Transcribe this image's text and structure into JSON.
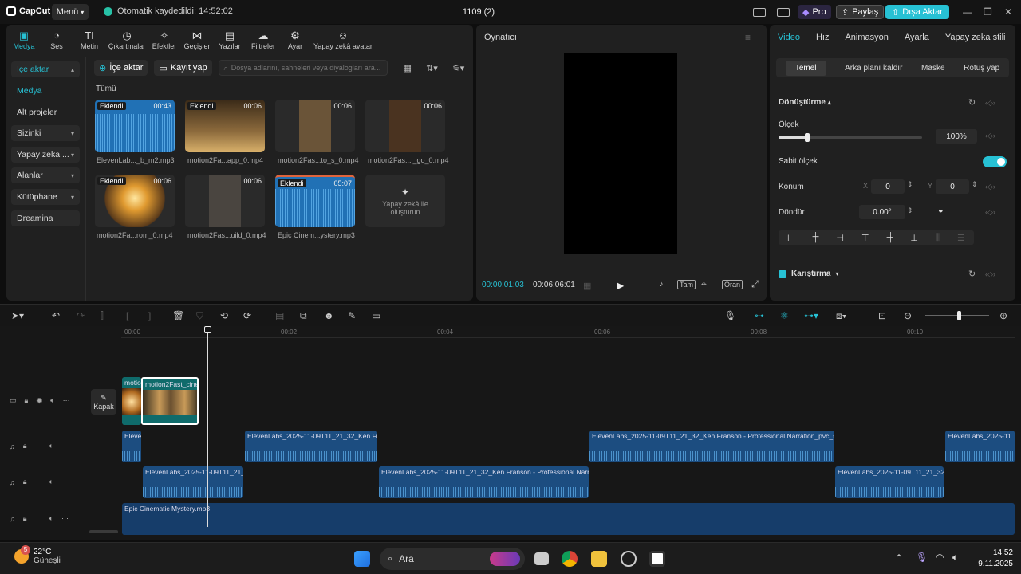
{
  "titlebar": {
    "app_name": "CapCut",
    "menu_label": "Menü",
    "autosave_text": "Otomatik kaydedildi: 14:52:02",
    "project_title": "1109 (2)",
    "pro_label": "Pro",
    "share_label": "Paylaş",
    "export_label": "Dışa Aktar"
  },
  "toolbar": {
    "items": [
      "Medya",
      "Ses",
      "Metin",
      "Çıkartmalar",
      "Efektler",
      "Geçişler",
      "Yazılar",
      "Filtreler",
      "Ayar",
      "Yapay zekâ avatar"
    ]
  },
  "sidenav": {
    "items": [
      "İçe aktar",
      "Medya",
      "Alt projeler",
      "Sizinki",
      "Yapay zeka ...",
      "Alanlar",
      "Kütüphane",
      "Dreamina"
    ]
  },
  "media": {
    "import_label": "İçe aktar",
    "record_label": "Kayıt yap",
    "search_placeholder": "Dosya adlarını, sahneleri veya diyalogları ara...",
    "all_label": "Tümü",
    "added_badge": "Eklendi",
    "items": [
      {
        "name": "ElevenLab..._b_m2.mp3",
        "duration": "00:43"
      },
      {
        "name": "motion2Fa...app_0.mp4",
        "duration": "00:06"
      },
      {
        "name": "motion2Fas...to_s_0.mp4",
        "duration": "00:06"
      },
      {
        "name": "motion2Fas...l_go_0.mp4",
        "duration": "00:06"
      },
      {
        "name": "motion2Fa...rom_0.mp4",
        "duration": "00:06"
      },
      {
        "name": "motion2Fas...uild_0.mp4",
        "duration": "00:06"
      },
      {
        "name": "Epic Cinem...ystery.mp3",
        "duration": "05:07"
      }
    ],
    "ai_create_label": "Yapay zekâ ile oluşturun"
  },
  "player": {
    "title": "Oynatıcı",
    "current_time": "00:00:01:03",
    "total_time": "00:06:06:01",
    "full_label": "Tam",
    "ratio_label": "Oran"
  },
  "props": {
    "tabs": [
      "Video",
      "Hız",
      "Animasyon",
      "Ayarla",
      "Yapay zeka stili"
    ],
    "subtabs": [
      "Temel",
      "Arka planı kaldır",
      "Maske",
      "Rötuş yap"
    ],
    "transform_label": "Dönüştürme",
    "scale_label": "Ölçek",
    "scale_value": "100%",
    "scale_fraction": 0.2,
    "uniform_scale_label": "Sabit ölçek",
    "position_label": "Konum",
    "x_label": "X",
    "x_value": "0",
    "y_label": "Y",
    "y_value": "0",
    "rotate_label": "Döndür",
    "rotate_value": "0.00°",
    "blend_label": "Karıştırma"
  },
  "timeline": {
    "ruler": [
      "00:00",
      "00:02",
      "00:04",
      "00:06",
      "00:08",
      "00:10"
    ],
    "cover_label": "Kapak",
    "video_clips": [
      "motio",
      "motion2Fast_cine"
    ],
    "audio_track1": [
      "Eleven",
      "ElevenLabs_2025-11-09T11_21_32_Ken Fran",
      "ElevenLabs_2025-11-09T11_21_32_Ken Franson - Professional Narration_pvc_sp1",
      "ElevenLabs_2025-11"
    ],
    "audio_track2": [
      "ElevenLabs_2025-11-09T11_21_32",
      "ElevenLabs_2025-11-09T11_21_32_Ken Franson - Professional Narratio",
      "ElevenLabs_2025-11-09T11_21_32_K"
    ],
    "music_clip": "Epic Cinematic Mystery.mp3"
  },
  "taskbar": {
    "weather_temp": "22°C",
    "weather_desc": "Güneşli",
    "search_label": "Ara",
    "time": "14:52",
    "date": "9.11.2025",
    "notification_count": "5"
  }
}
